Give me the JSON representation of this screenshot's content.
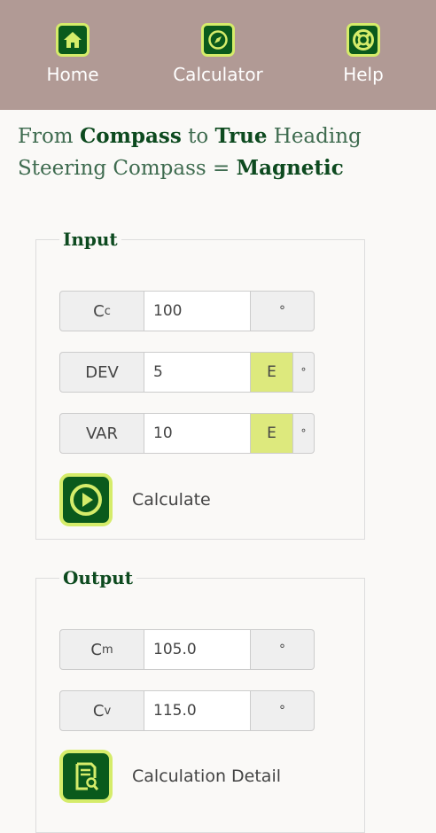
{
  "nav": {
    "items": [
      {
        "label": "Home",
        "icon": "home-icon"
      },
      {
        "label": "Calculator",
        "icon": "compass-icon"
      },
      {
        "label": "Help",
        "icon": "lifebuoy-icon"
      }
    ]
  },
  "headline": {
    "line1": {
      "from": "From",
      "compass": "Compass",
      "to": "to",
      "true": "True",
      "heading": "Heading"
    },
    "line2": {
      "prefix": "Steering Compass =",
      "value": "Magnetic"
    }
  },
  "input": {
    "legend": "Input",
    "cc": {
      "label_main": "C",
      "label_sub": "c",
      "value": "100",
      "unit": "°"
    },
    "dev": {
      "label": "DEV",
      "value": "5",
      "direction": "E",
      "unit": "°"
    },
    "var": {
      "label": "VAR",
      "value": "10",
      "direction": "E",
      "unit": "°"
    },
    "calculate_label": "Calculate"
  },
  "output": {
    "legend": "Output",
    "cm": {
      "label_main": "C",
      "label_sub": "m",
      "value": "105.0",
      "unit": "°"
    },
    "cv": {
      "label_main": "C",
      "label_sub": "v",
      "value": "115.0",
      "unit": "°"
    },
    "detail_label": "Calculation Detail"
  },
  "colors": {
    "navbar": "#b19a95",
    "accent_green": "#0a5a1c",
    "icon_border": "#d5ec6a",
    "direction_bg": "#dde97d"
  }
}
